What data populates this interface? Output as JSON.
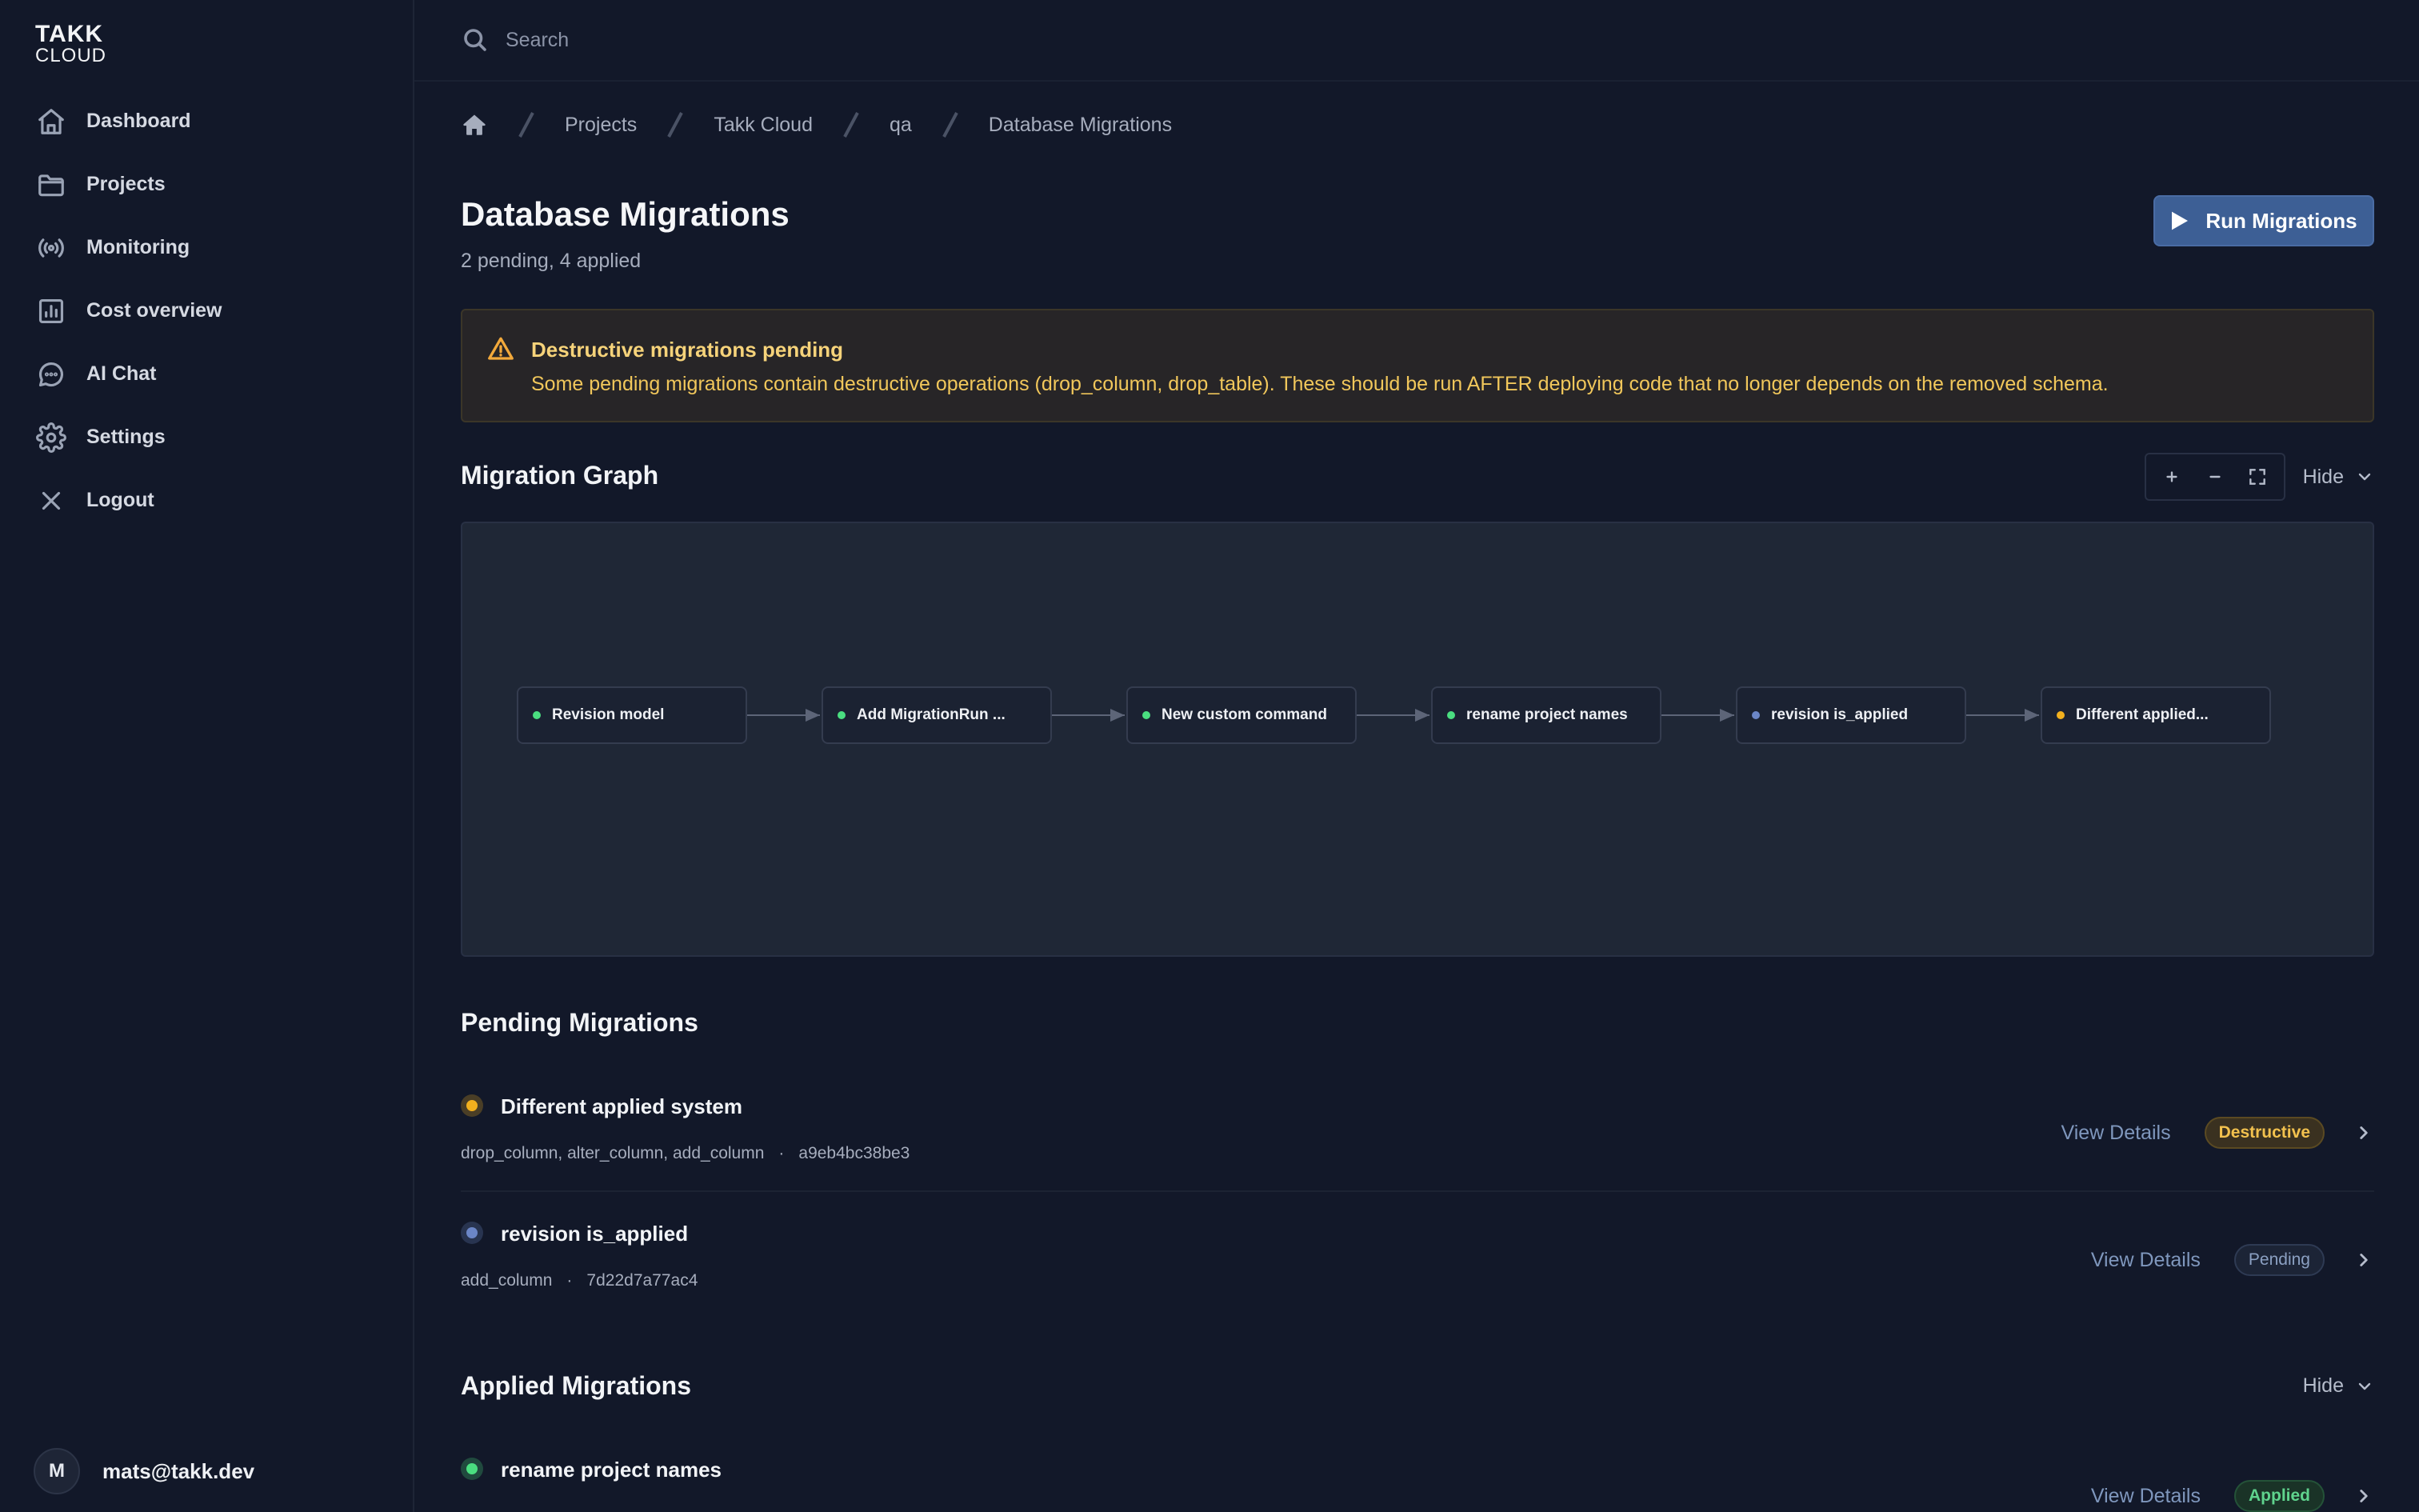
{
  "logo": {
    "line1": "TAKK",
    "line2": "CLOUD"
  },
  "sidebar": {
    "items": [
      {
        "label": "Dashboard",
        "icon": "home-icon"
      },
      {
        "label": "Projects",
        "icon": "folder-icon"
      },
      {
        "label": "Monitoring",
        "icon": "broadcast-icon"
      },
      {
        "label": "Cost overview",
        "icon": "chart-icon"
      },
      {
        "label": "AI Chat",
        "icon": "chat-icon"
      },
      {
        "label": "Settings",
        "icon": "gear-icon"
      },
      {
        "label": "Logout",
        "icon": "close-icon"
      }
    ],
    "user": {
      "initial": "M",
      "email": "mats@takk.dev"
    }
  },
  "search": {
    "placeholder": "Search"
  },
  "breadcrumb": [
    "Projects",
    "Takk Cloud",
    "qa",
    "Database Migrations"
  ],
  "page": {
    "title": "Database Migrations",
    "subtitle": "2 pending, 4 applied",
    "run_button": "Run Migrations"
  },
  "warning": {
    "title": "Destructive migrations pending",
    "text": "Some pending migrations contain destructive operations (drop_column, drop_table). These should be run AFTER deploying code that no longer depends on the removed schema."
  },
  "graph": {
    "title": "Migration Graph",
    "hide_label": "Hide",
    "nodes": [
      {
        "label": "Revision model",
        "status": "applied"
      },
      {
        "label": "Add MigrationRun ...",
        "status": "applied"
      },
      {
        "label": "New custom command",
        "status": "applied"
      },
      {
        "label": "rename project names",
        "status": "applied"
      },
      {
        "label": "revision is_applied",
        "status": "pending"
      },
      {
        "label": "Different applied...",
        "status": "destructive"
      }
    ]
  },
  "pending": {
    "title": "Pending Migrations",
    "rows": [
      {
        "name": "Different applied system",
        "operations": "drop_column, alter_column, add_column",
        "hash": "a9eb4bc38be3",
        "view": "View Details",
        "badge": "Destructive"
      },
      {
        "name": "revision is_applied",
        "operations": "add_column",
        "hash": "7d22d7a77ac4",
        "view": "View Details",
        "badge": "Pending"
      }
    ]
  },
  "applied": {
    "title": "Applied Migrations",
    "hide_label": "Hide",
    "rows": [
      {
        "name": "rename project names",
        "view": "View Details",
        "badge": "Applied"
      }
    ]
  },
  "colors": {
    "applied": "#4ade80",
    "pending": "#6b86c7",
    "destructive": "#f2b01e",
    "accent": "#3d5f95"
  }
}
